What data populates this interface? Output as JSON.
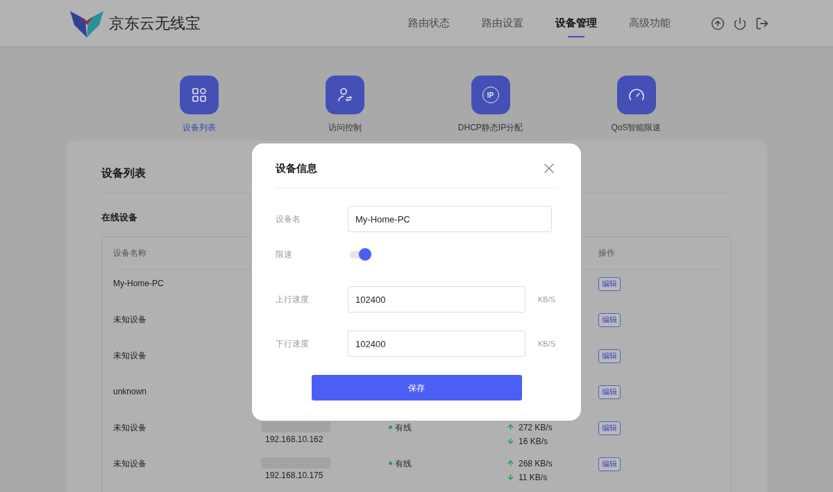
{
  "header": {
    "brand": "京东云无线宝",
    "nav": [
      {
        "label": "路由状态",
        "selected": false
      },
      {
        "label": "路由设置",
        "selected": false
      },
      {
        "label": "设备管理",
        "selected": true
      },
      {
        "label": "高级功能",
        "selected": false
      }
    ]
  },
  "subnav": [
    {
      "kind": "grid",
      "label": "设备列表",
      "selected": true
    },
    {
      "kind": "user",
      "label": "访问控制",
      "selected": false
    },
    {
      "kind": "ip",
      "icon_text": "IP",
      "label": "DHCP静态IP分配",
      "selected": false
    },
    {
      "kind": "gauge",
      "label": "QoS智能限速",
      "selected": false
    }
  ],
  "panel": {
    "title": "设备列表",
    "section_title": "在线设备",
    "columns": {
      "name": "设备名称",
      "action": "操作"
    },
    "rows": [
      {
        "name": "My-Home-PC",
        "action": "编辑"
      },
      {
        "name": "未知设备",
        "action": "编辑"
      },
      {
        "name": "未知设备",
        "action": "编辑"
      },
      {
        "name": "unknown",
        "action": "编辑"
      },
      {
        "name": "未知设备",
        "mac_blurred": true,
        "ip": "192.168.10.162",
        "connection": "有线",
        "up": "272 KB/s",
        "down": "16 KB/s",
        "action": "编辑"
      },
      {
        "name": "未知设备",
        "mac_blurred": true,
        "ip": "192.168.10.175",
        "connection": "有线",
        "up": "268 KB/s",
        "down": "11 KB/s",
        "action": "编辑"
      }
    ]
  },
  "modal": {
    "title": "设备信息",
    "fields": [
      {
        "kind": "text",
        "label": "设备名",
        "value": "My-Home-PC"
      },
      {
        "kind": "toggle",
        "label": "限速",
        "on": true
      },
      {
        "kind": "text",
        "label": "上行速度",
        "value": "102400",
        "unit": "KB/S"
      },
      {
        "kind": "text",
        "label": "下行速度",
        "value": "102400",
        "unit": "KB/S"
      }
    ],
    "button": "保存"
  }
}
